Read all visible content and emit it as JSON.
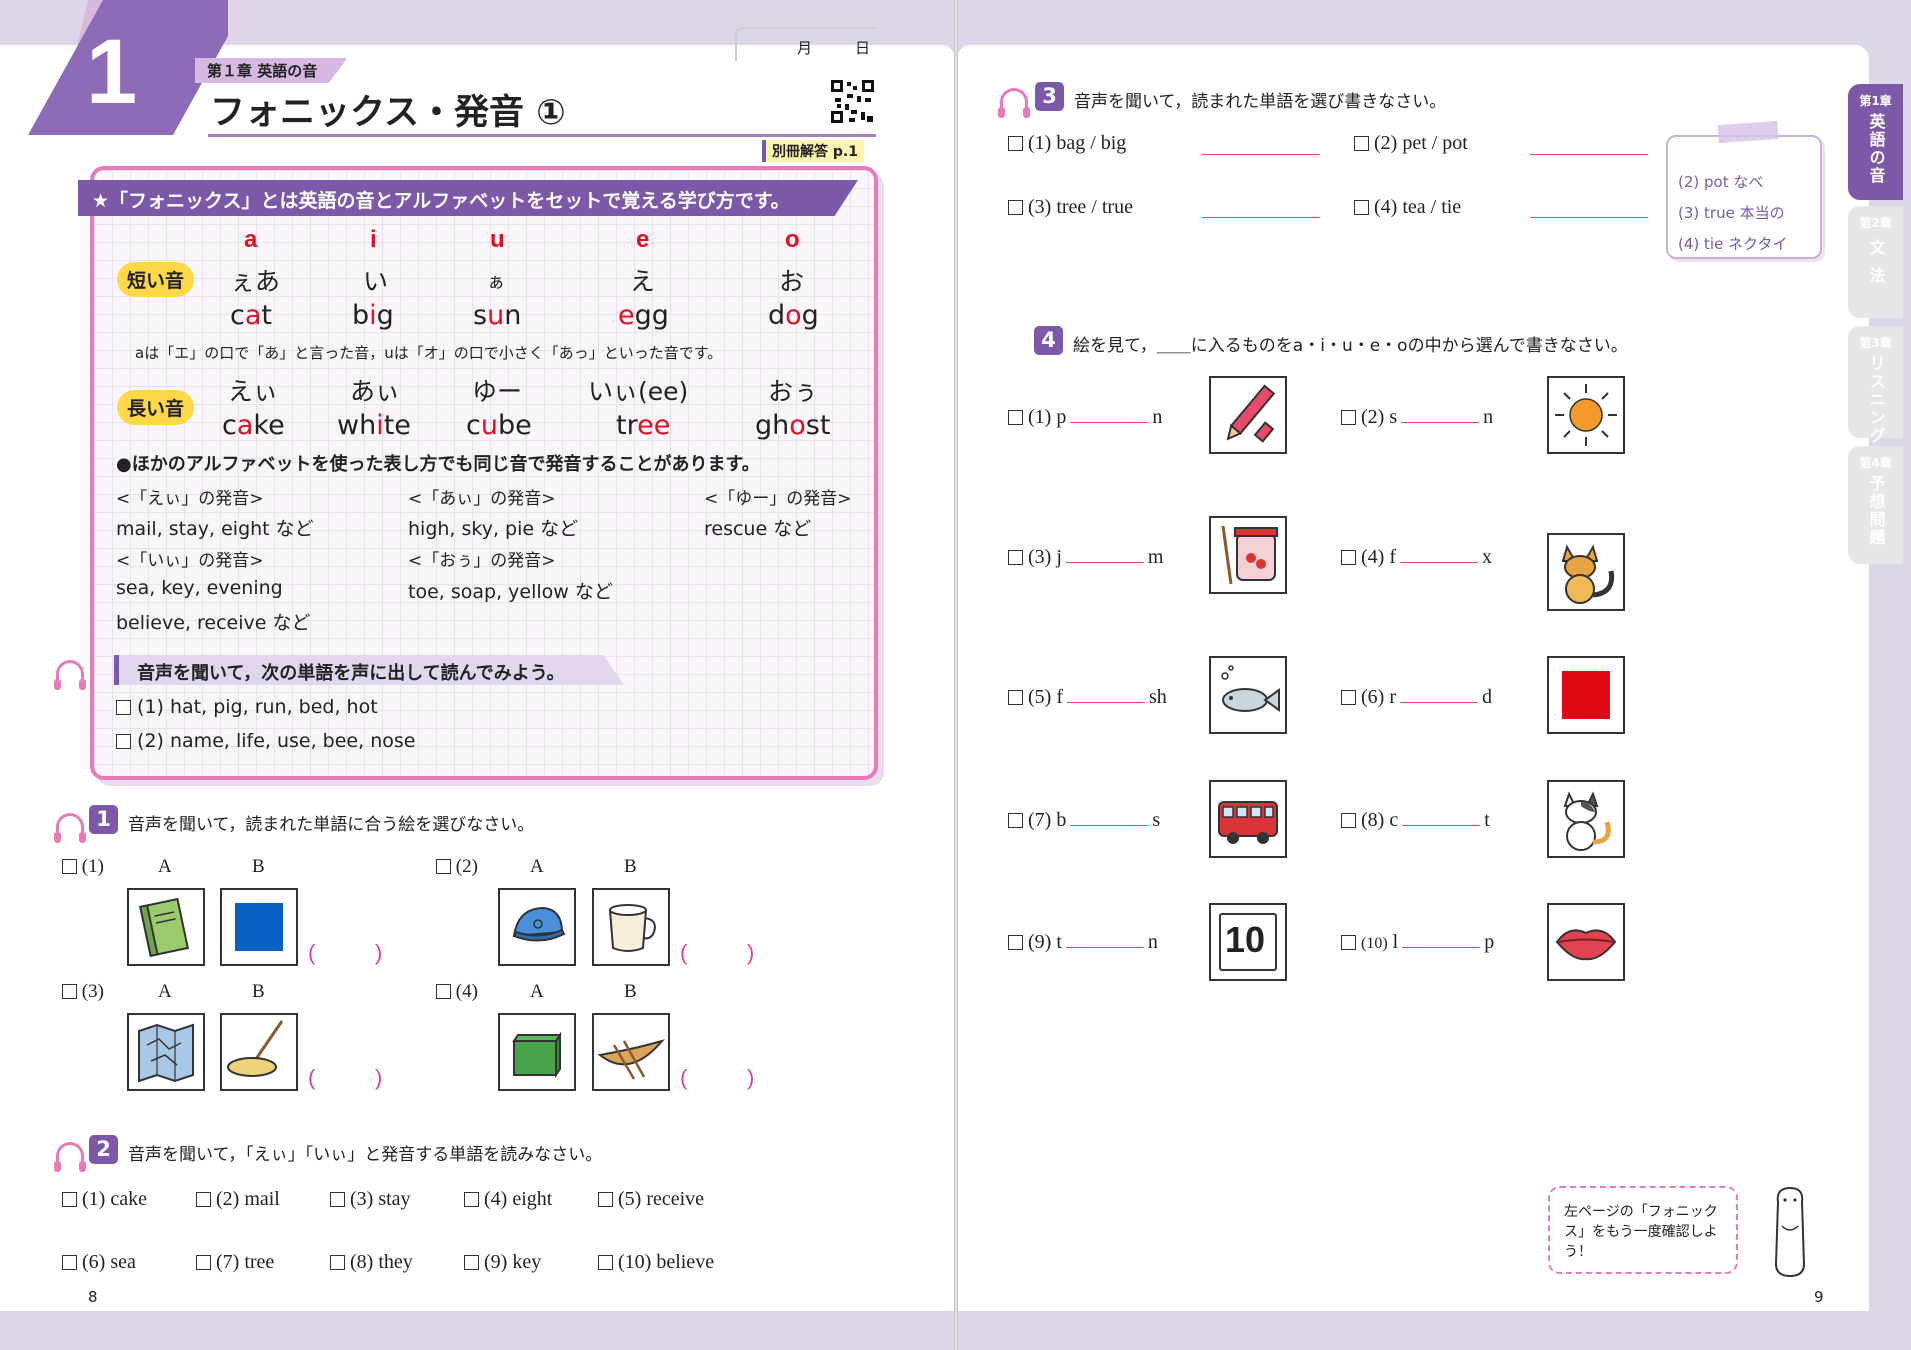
{
  "left": {
    "big_number": "1",
    "chapter_label": "第１章 英語の音",
    "title": "フォニックス・発音 ①",
    "date_month": "月",
    "date_day": "日",
    "answer_ref": "別冊解答 p.1",
    "phonics_box": {
      "headline": "★「フォニックス」とは英語の音とアルファベットをセットで覚える学び方です。",
      "short_label": "短い音",
      "long_label": "長い音",
      "vowels": [
        {
          "letter": "a",
          "kana": "ぇあ",
          "word_pre": "c",
          "word_hl": "a",
          "word_post": "t"
        },
        {
          "letter": "i",
          "kana": "い",
          "word_pre": "b",
          "word_hl": "i",
          "word_post": "g"
        },
        {
          "letter": "u",
          "kana": "ぁ",
          "word_pre": "s",
          "word_hl": "u",
          "word_post": "n"
        },
        {
          "letter": "e",
          "kana": "え",
          "word_pre": "",
          "word_hl": "e",
          "word_post": "gg"
        },
        {
          "letter": "o",
          "kana": "お",
          "word_pre": "d",
          "word_hl": "o",
          "word_post": "g"
        }
      ],
      "short_note": "aは「エ」の口で「あ」と言った音，uは「オ」の口で小さく「あっ」といった音です。",
      "long": [
        {
          "kana": "えぃ",
          "word_pre": "c",
          "word_hl": "a",
          "word_post": "ke"
        },
        {
          "kana": "あぃ",
          "word_pre": "wh",
          "word_hl": "i",
          "word_post": "te"
        },
        {
          "kana": "ゆー",
          "word_pre": "c",
          "word_hl": "u",
          "word_post": "be"
        },
        {
          "kana": "いぃ(ee)",
          "word_pre": "tr",
          "word_hl": "ee",
          "word_post": ""
        },
        {
          "kana": "おぅ",
          "word_pre": "gh",
          "word_hl": "o",
          "word_post": "st"
        }
      ],
      "other_note": "●ほかのアルファベットを使った表し方でも同じ音で発音することがあります。",
      "ei_head": "<「えぃ」の発音>",
      "ei_line": "mail, stay, eight など",
      "ai_head": "<「あぃ」の発音>",
      "ai_line": "high, sky, pie など",
      "yu_head": "<「ゆー」の発音>",
      "yu_line": "rescue など",
      "ii_head": "<「いぃ」の発音>",
      "ii_line1": "sea, key, evening",
      "ii_line2": "believe, receive など",
      "ou_head": "<「おぅ」の発音>",
      "ou_line": "toe, soap, yellow など",
      "listen_head": "音声を聞いて，次の単語を声に出して読んでみよう。",
      "listen_1": "(1) hat, pig, run, bed, hot",
      "listen_2": "(2) name, life, use, bee, nose"
    },
    "q1": {
      "num": "1",
      "instruction": "音声を聞いて，読まれた単語に合う絵を選びなさい。",
      "items": [
        {
          "label": "(1)",
          "a": "A",
          "b": "B",
          "pic_a": "notebook-icon",
          "pic_b": "blue-square-icon"
        },
        {
          "label": "(2)",
          "a": "A",
          "b": "B",
          "pic_a": "cap-icon",
          "pic_b": "cup-icon"
        },
        {
          "label": "(3)",
          "a": "A",
          "b": "B",
          "pic_a": "map-icon",
          "pic_b": "mop-icon"
        },
        {
          "label": "(4)",
          "a": "A",
          "b": "B",
          "pic_a": "box-icon",
          "pic_b": "boat-icon"
        }
      ],
      "paren_open": "(",
      "paren_close": ")"
    },
    "q2": {
      "num": "2",
      "instruction": "音声を聞いて，「えぃ」「いぃ」と発音する単語を読みなさい。",
      "row1": [
        "(1) cake",
        "(2) mail",
        "(3) stay",
        "(4) eight",
        "(5) receive"
      ],
      "row2": [
        "(6) sea",
        "(7) tree",
        "(8) they",
        "(9) key",
        "(10) believe"
      ]
    },
    "page_num": "8"
  },
  "right": {
    "q3": {
      "num": "3",
      "instruction": "音声を聞いて，読まれた単語を選び書きなさい。",
      "items": [
        "(1) bag / big",
        "(2) pet / pot",
        "(3) tree / true",
        "(4) tea / tie"
      ],
      "note": [
        "(2) pot なべ",
        "(3) true 本当の",
        "(4) tie ネクタイ"
      ]
    },
    "q4": {
      "num": "4",
      "instruction": "絵を見て，＿＿に入るものをa・i・u・e・oの中から選んで書きなさい。",
      "items": [
        {
          "label": "(1)",
          "pre": "p",
          "post": "n",
          "pic": "pen-icon"
        },
        {
          "label": "(2)",
          "pre": "s",
          "post": "n",
          "pic": "sun-icon"
        },
        {
          "label": "(3)",
          "pre": "j",
          "post": "m",
          "pic": "jam-icon"
        },
        {
          "label": "(4)",
          "pre": "f",
          "post": "x",
          "pic": "fox-icon"
        },
        {
          "label": "(5)",
          "pre": "f",
          "post": "sh",
          "pic": "fish-icon"
        },
        {
          "label": "(6)",
          "pre": "r",
          "post": "d",
          "pic": "red-square-icon"
        },
        {
          "label": "(7)",
          "pre": "b",
          "post": "s",
          "pic": "bus-icon"
        },
        {
          "label": "(8)",
          "pre": "c",
          "post": "t",
          "pic": "cat-icon"
        },
        {
          "label": "(9)",
          "pre": "t",
          "post": "n",
          "pic": "ten-icon",
          "ten": "10"
        },
        {
          "label": "(10)",
          "pre": "l",
          "post": "p",
          "pic": "lips-icon"
        }
      ]
    },
    "speech": "左ページの「フォニックス」をもう一度確認しよう！",
    "page_num": "9",
    "tabs": [
      {
        "chapter": "第1章",
        "title": "英語の音",
        "active": true
      },
      {
        "chapter": "第2章",
        "title": "文法",
        "active": false
      },
      {
        "chapter": "第3章",
        "title": "リスニング",
        "active": false
      },
      {
        "chapter": "第4章",
        "title": "予想問題",
        "active": false
      }
    ]
  },
  "colors": {
    "accent": "#7b59a8",
    "pink": "#e0409a",
    "red": "#e01020",
    "yellow": "#ffd84a"
  }
}
